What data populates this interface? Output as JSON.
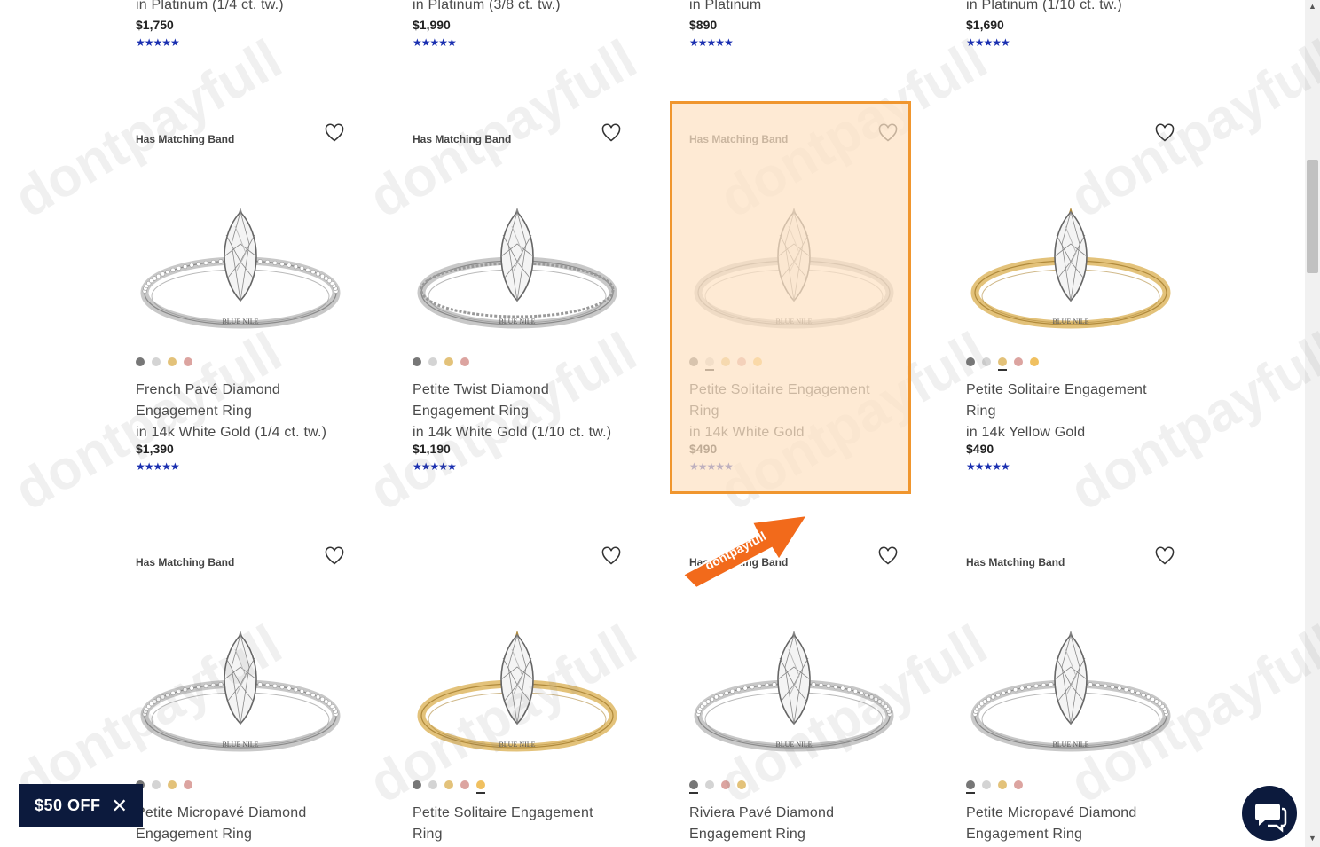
{
  "top_row": [
    {
      "metal": "in Platinum (1/4 ct. tw.)",
      "price": "$1,750",
      "stars": "★★★★★"
    },
    {
      "metal": "in Platinum (3/8 ct. tw.)",
      "price": "$1,990",
      "stars": "★★★★★"
    },
    {
      "metal": "in Platinum",
      "price": "$890",
      "stars": "★★★★★"
    },
    {
      "metal": "in Platinum (1/10 ct. tw.)",
      "price": "$1,690",
      "stars": "★★★★★"
    }
  ],
  "row2": [
    {
      "badge": "Has Matching Band",
      "name": "French Pavé Diamond Engagement Ring",
      "metal": "in 14k White Gold (1/4 ct. tw.)",
      "price": "$1,390",
      "stars": "★★★★★",
      "band": "pave",
      "band_color": "#c8c8c8"
    },
    {
      "badge": "Has Matching Band",
      "name": "Petite Twist Diamond Engagement Ring",
      "metal": "in 14k White Gold (1/10 ct. tw.)",
      "price": "$1,190",
      "stars": "★★★★★",
      "band": "twist",
      "band_color": "#c8c8c8"
    },
    {
      "badge": "Has Matching Band",
      "name": "Petite Solitaire Engagement Ring",
      "metal": "in 14k White Gold",
      "price": "$490",
      "stars": "★★★★★",
      "band": "plain",
      "band_color": "#c8c8c8"
    },
    {
      "badge": "",
      "name": "Petite Solitaire Engagement Ring",
      "metal": "in 14k Yellow Gold",
      "price": "$490",
      "stars": "★★★★★",
      "band": "plain",
      "band_color": "#e3c27a"
    }
  ],
  "row3": [
    {
      "badge": "Has Matching Band",
      "name": "Petite Micropavé Diamond Engagement Ring",
      "band": "pave",
      "band_color": "#c8c8c8"
    },
    {
      "badge": "",
      "name": "Petite Solitaire Engagement Ring",
      "band": "plain",
      "band_color": "#e3c27a"
    },
    {
      "badge": "Has Matching Band",
      "name": "Riviera Pavé Diamond Engagement Ring",
      "band": "pave",
      "band_color": "#c8c8c8"
    },
    {
      "badge": "Has Matching Band",
      "name": "Petite Micropavé Diamond Engagement Ring",
      "band": "pave",
      "band_color": "#c8c8c8"
    }
  ],
  "ring_logo": "BLUE NILE",
  "promo": {
    "label": "$50 OFF",
    "close": "✕"
  },
  "watermark": "dontpayfull",
  "arrow_label": "dontpayfull",
  "colors": {
    "accent": "#f0962e",
    "navy": "#0c1a3d",
    "star": "#1a2fb0"
  }
}
